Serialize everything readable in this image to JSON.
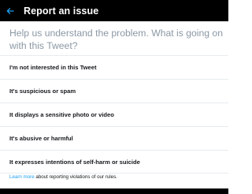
{
  "header": {
    "title": "Report an issue",
    "back_icon": "arrow-left-icon",
    "background": "#000000",
    "accent": "#1da1f2"
  },
  "prompt": "Help us understand the problem. What is going on with this Tweet?",
  "options": [
    {
      "label": "I'm not interested in this Tweet"
    },
    {
      "label": "It's suspicious or spam"
    },
    {
      "label": "It displays a sensitive photo or video"
    },
    {
      "label": "It's abusive or harmful"
    },
    {
      "label": "It expresses intentions of self-harm or suicide"
    }
  ],
  "footnote": {
    "link_text": "Learn more",
    "text": " about reporting violations of our rules."
  }
}
